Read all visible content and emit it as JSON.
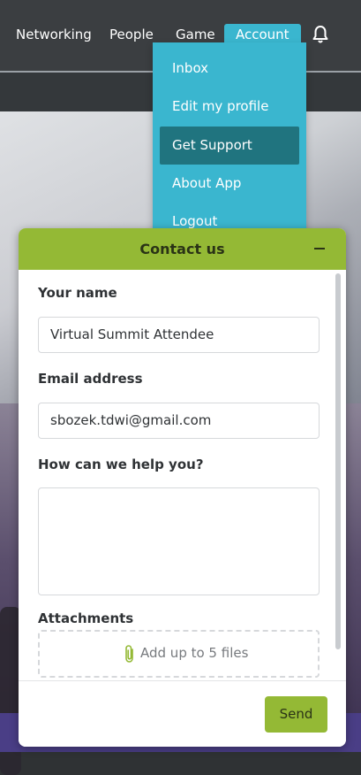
{
  "nav": {
    "items": [
      {
        "label": "Networking"
      },
      {
        "label": "People"
      },
      {
        "label": "Game"
      },
      {
        "label": "Account"
      }
    ],
    "active": "Account",
    "bell_icon": "bell-icon"
  },
  "dropdown": {
    "items": [
      {
        "label": "Inbox"
      },
      {
        "label": "Edit my profile"
      },
      {
        "label": "Get Support"
      },
      {
        "label": "About App"
      },
      {
        "label": "Logout"
      }
    ],
    "active": "Get Support"
  },
  "contact": {
    "title": "Contact us",
    "name_label": "Your name",
    "name_value": "Virtual Summit Attendee",
    "email_label": "Email address",
    "email_value": "sbozek.tdwi@gmail.com",
    "help_label": "How can we help you?",
    "help_value": "",
    "attachments_label": "Attachments",
    "dropzone_text": "Add up to 5 files",
    "send_label": "Send",
    "minimize_icon": "minus-icon",
    "paperclip_icon": "paperclip-icon"
  },
  "colors": {
    "nav_bg": "#3b3e41",
    "accent_blue": "#3ab6cf",
    "active_menu": "#20747f",
    "accent_green": "#94b935"
  }
}
